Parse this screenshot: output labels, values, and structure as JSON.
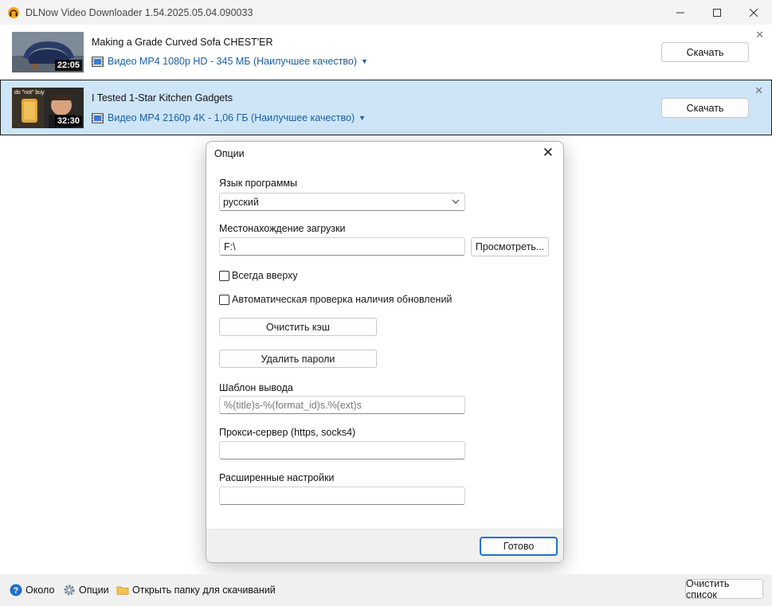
{
  "window": {
    "title": "DLNow Video Downloader 1.54.2025.05.04.090033",
    "minimize_icon": "minimize-icon",
    "maximize_icon": "maximize-icon",
    "close_icon": "close-icon"
  },
  "videos": [
    {
      "title": "Making a Grade Curved Sofa CHEST'ER",
      "duration": "22:05",
      "format": "Видео MP4 1080p HD - 345 МБ (Наилучшее качество)",
      "download_label": "Скачать"
    },
    {
      "title": "I Tested 1-Star Kitchen Gadgets",
      "duration": "32:30",
      "thumb_caption": "do \"not\" buy",
      "format": "Видео MP4 2160p 4K - 1,06 ГБ (Наилучшее качество)",
      "download_label": "Скачать"
    }
  ],
  "dialog": {
    "title": "Опции",
    "language_label": "Язык программы",
    "language_value": "русский",
    "location_label": "Местонахождение загрузки",
    "location_value": "F:\\",
    "browse_label": "Просмотреть...",
    "always_on_top_label": "Всегда вверху",
    "auto_update_label": "Автоматическая проверка наличия обновлений",
    "clear_cache_label": "Очистить кэш",
    "delete_passwords_label": "Удалить пароли",
    "template_label": "Шаблон вывода",
    "template_value": "%(title)s-%(format_id)s.%(ext)s",
    "proxy_label": "Прокси-сервер (https, socks4)",
    "proxy_value": "",
    "advanced_label": "Расширенные настройки",
    "advanced_value": "",
    "ok_label": "Готово"
  },
  "statusbar": {
    "about_label": "Около",
    "options_label": "Опции",
    "open_folder_label": "Открыть папку для скачиваний",
    "clear_list_label": "Очистить список"
  },
  "colors": {
    "accent": "#1a5da6",
    "selected_row": "#cde5f7",
    "ok_border": "#1f6fcf"
  }
}
